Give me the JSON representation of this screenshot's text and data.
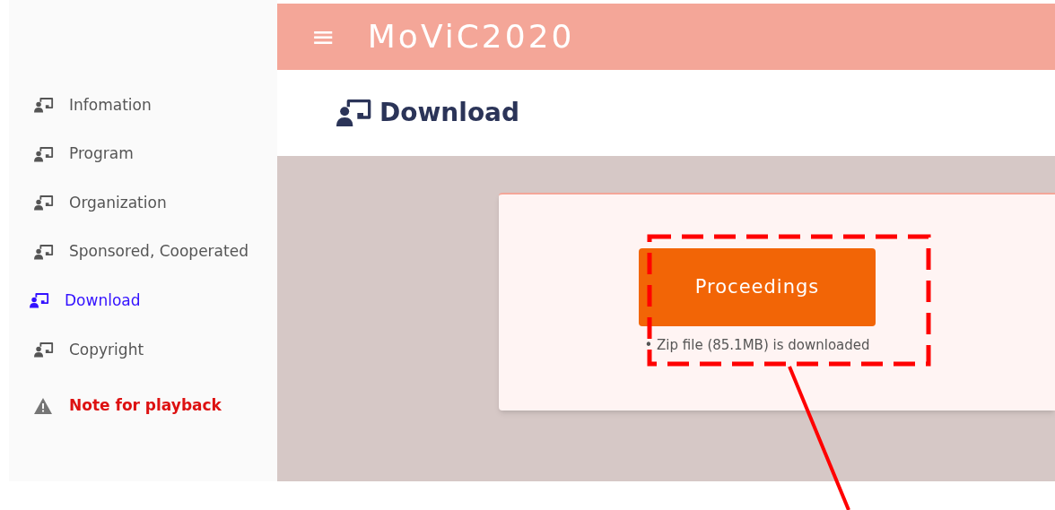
{
  "header": {
    "menu_glyph": "≡",
    "title": "MoViC2020"
  },
  "sidebar": {
    "items": [
      {
        "kind": "page",
        "label": "Infomation",
        "selected": false
      },
      {
        "kind": "page",
        "label": "Program",
        "selected": false
      },
      {
        "kind": "page",
        "label": "Organization",
        "selected": false
      },
      {
        "kind": "page",
        "label": "Sponsored, Cooperated",
        "selected": false
      },
      {
        "kind": "page",
        "label": "Download",
        "selected": true
      },
      {
        "kind": "page",
        "label": "Copyright",
        "selected": false
      },
      {
        "kind": "note",
        "label": "Note for playback",
        "selected": false
      }
    ]
  },
  "page_title": "Download",
  "card": {
    "button": "Proceedings",
    "note": "• Zip file (85.1MB) is downloaded"
  },
  "annotation": {
    "kind": "callout"
  }
}
